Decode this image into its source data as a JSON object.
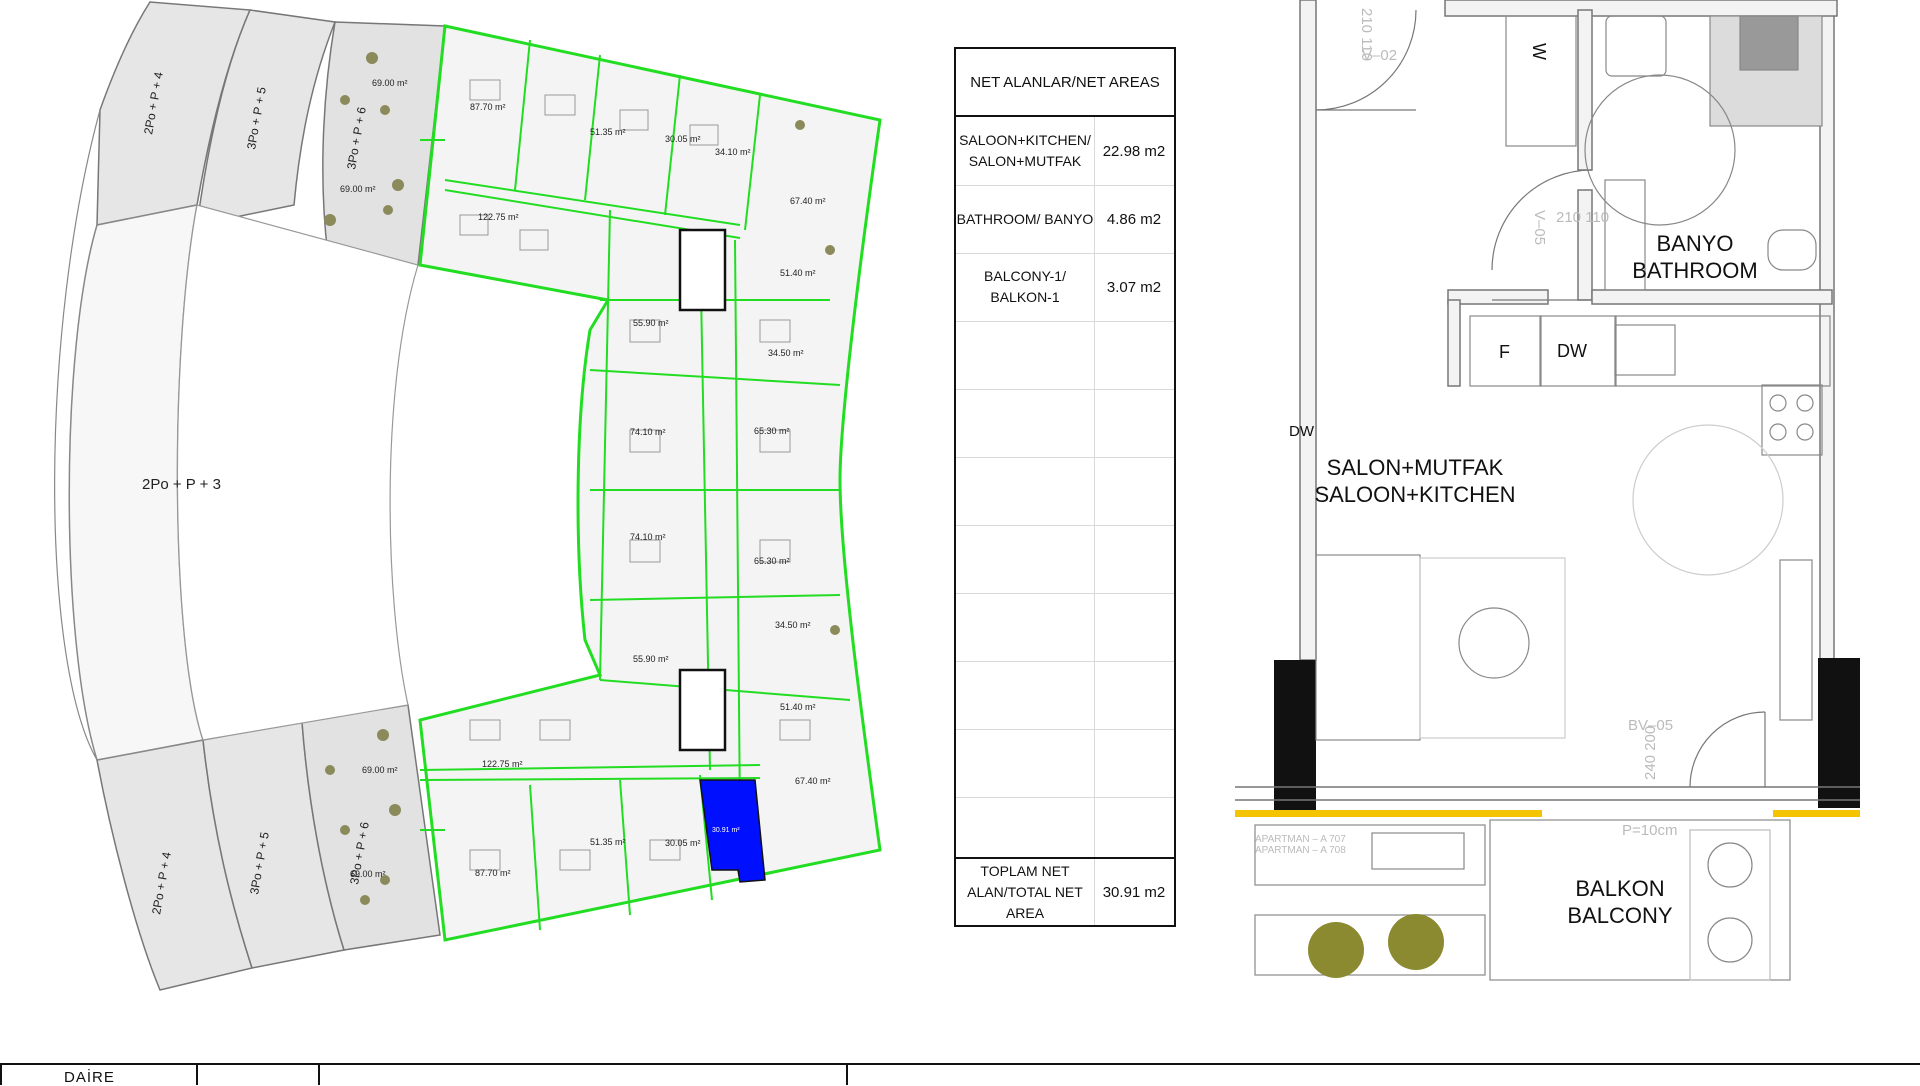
{
  "site_plan": {
    "block_labels": {
      "left_center": "2Po + P + 3",
      "top_left_1": "2Po + P + 4",
      "top_left_2": "3Po + P + 5",
      "top_left_3": "3Po + P + 6",
      "bottom_left_1": "2Po + P + 4",
      "bottom_left_2": "3Po + P + 5",
      "bottom_left_3": "3Po + P + 6"
    },
    "unit_areas": {
      "top_row": [
        "87.70 m²",
        "51.35 m²",
        "30.05 m²",
        "34.10 m²",
        "67.40 m²"
      ],
      "top_garden_1": "69.00 m²",
      "top_garden_2": "69.00 m²",
      "top_big": "122.75 m²",
      "right_col": [
        "51.40 m²",
        "34.50 m²",
        "65.30 m²",
        "65.30 m²",
        "34.50 m²",
        "51.40 m²"
      ],
      "center_col": [
        "55.90 m²",
        "74.10 m²",
        "74.10 m²",
        "55.90 m²"
      ],
      "bottom_big": "122.75 m²",
      "bottom_garden_1": "69.00 m²",
      "bottom_garden_2": "69.00 m²",
      "bottom_row": [
        "87.70 m²",
        "51.35 m²",
        "30.05 m²",
        "67.40 m²"
      ],
      "highlighted_unit": "30.91 m²"
    },
    "highlight_color": "#0010ff",
    "outline_color": "#22dd22"
  },
  "net_areas": {
    "title": "NET ALANLAR/NET AREAS",
    "rows": [
      {
        "label": "SALOON+KITCHEN/ SALON+MUTFAK",
        "value": "22.98 m2"
      },
      {
        "label": "BATHROOM/ BANYO",
        "value": "4.86 m2"
      },
      {
        "label": "BALCONY-1/ BALKON-1",
        "value": "3.07 m2"
      }
    ],
    "total_label": "TOPLAM NET ALAN/TOTAL NET AREA",
    "total_value": "30.91 m2"
  },
  "unit_plan": {
    "rooms": {
      "bathroom_tr": "BANYO",
      "bathroom_en": "BATHROOM",
      "living_tr": "SALON+MUTFAK",
      "living_en": "SALOON+KITCHEN",
      "balcony_tr": "BALKON",
      "balcony_en": "BALCONY"
    },
    "fixtures": {
      "washer": "W",
      "fridge": "F",
      "dishwasher": "DW",
      "dw_side": "DW"
    },
    "door_tags": {
      "v02": "V–02",
      "v05": "V–05",
      "bv05": "BV–05",
      "d210_110_a": "210 110",
      "d210_110_b": "210 110",
      "d240_200": "240 200",
      "p10": "P=10cm",
      "apt_a707": "APARTMAN – A 707",
      "apt_a708": "APARTMAN – A 708"
    },
    "wall_color": "#111111",
    "accent_color": "#f5c400"
  },
  "title_block": {
    "label": "DAİRE"
  }
}
